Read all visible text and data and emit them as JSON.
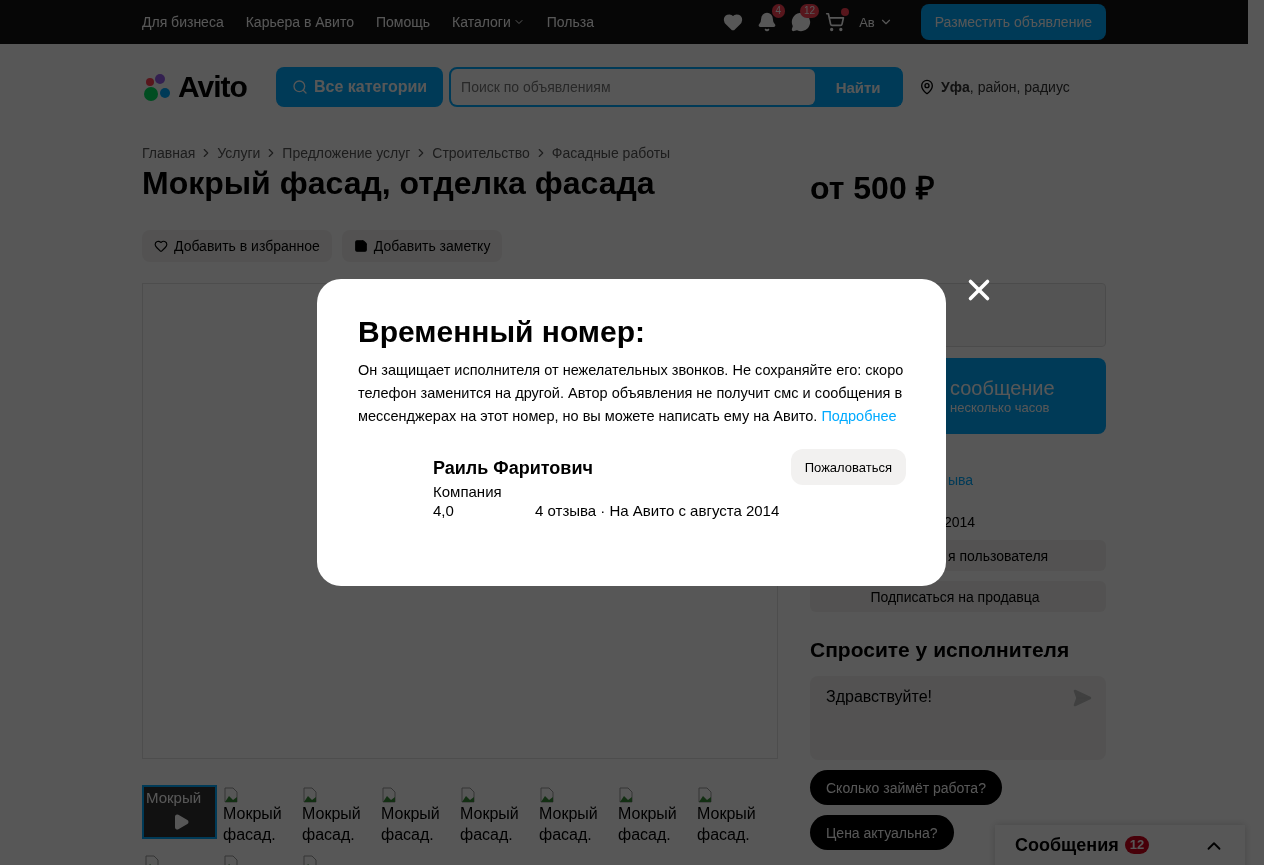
{
  "top_bar": {
    "links": [
      {
        "label": "Для бизнеса",
        "dropdown": false
      },
      {
        "label": "Карьера в Авито",
        "dropdown": false
      },
      {
        "label": "Помощь",
        "dropdown": false
      },
      {
        "label": "Каталоги",
        "dropdown": true
      },
      {
        "label": "Польза",
        "dropdown": false
      }
    ],
    "notifications_badge": "4",
    "messages_badge": "12",
    "cart_has_items": true,
    "avatar_alt": "Ав",
    "post_button": "Разместить объявление"
  },
  "header": {
    "logo": "Avito",
    "categories_button": "Все категории",
    "search": {
      "placeholder": "Поиск по объявлениям"
    },
    "search_button": "Найти",
    "location": "**Уфа**, район, радиус"
  },
  "breadcrumbs": [
    "Главная",
    "Услуги",
    "Предложение услуг",
    "Строительство",
    "Фасадные работы"
  ],
  "title": "Мокрый фасад, отделка фасада",
  "price": "от 500 ₽",
  "actions": [
    {
      "kind": "favorite",
      "label": "Добавить в избранное"
    },
    {
      "kind": "note",
      "label": "Добавить заметку"
    }
  ],
  "thumbnails": [
    {
      "kind": "video",
      "label": "Мокрый",
      "selected": true
    },
    {
      "kind": "image",
      "label": "Мокрый фасад.",
      "selected": false
    },
    {
      "kind": "image",
      "label": "Мокрый фасад.",
      "selected": false
    },
    {
      "kind": "image",
      "label": "Мокрый фасад.",
      "selected": false
    },
    {
      "kind": "image",
      "label": "Мокрый фасад.",
      "selected": false
    },
    {
      "kind": "image",
      "label": "Мокрый фасад.",
      "selected": false
    },
    {
      "kind": "image",
      "label": "Мокрый фасад.",
      "selected": false
    },
    {
      "kind": "image",
      "label": "Мокрый фасад.",
      "selected": false
    },
    {
      "kind": "image",
      "selected": false
    },
    {
      "kind": "image",
      "selected": false
    },
    {
      "kind": "image",
      "selected": false
    }
  ],
  "sidebar": {
    "message_button": {
      "title": "сообщение",
      "subtitle": "несколько часов"
    },
    "reviews_link": "ыва",
    "since": "2014",
    "user_button": "я пользователя",
    "subscribe_button": "Подписаться на продавца",
    "ask": {
      "title": "Спросите у исполнителя",
      "message": {
        "value": "Здравствуйте!"
      },
      "quick_questions": [
        "Сколько займёт работа?",
        "Цена актуальна?"
      ]
    }
  },
  "messenger": {
    "title": "Сообщения",
    "badge": "12"
  },
  "modal": {
    "title": "Временный номер:",
    "text": "Он защищает исполнителя от нежелательных звонков. Не сохраняйте его: скоро телефон заменится на другой. Автор объявления не получит смс и сообщения в мессенджерах на этот номер, но вы можете написать ему на Авито.",
    "link": "Подробнее",
    "seller": {
      "name": "Раиль Фаритович",
      "type": "Компания",
      "rating": "4,0",
      "details": "4 отзыва · На Авито с августа 2014"
    },
    "report_button": "Пожаловаться"
  }
}
